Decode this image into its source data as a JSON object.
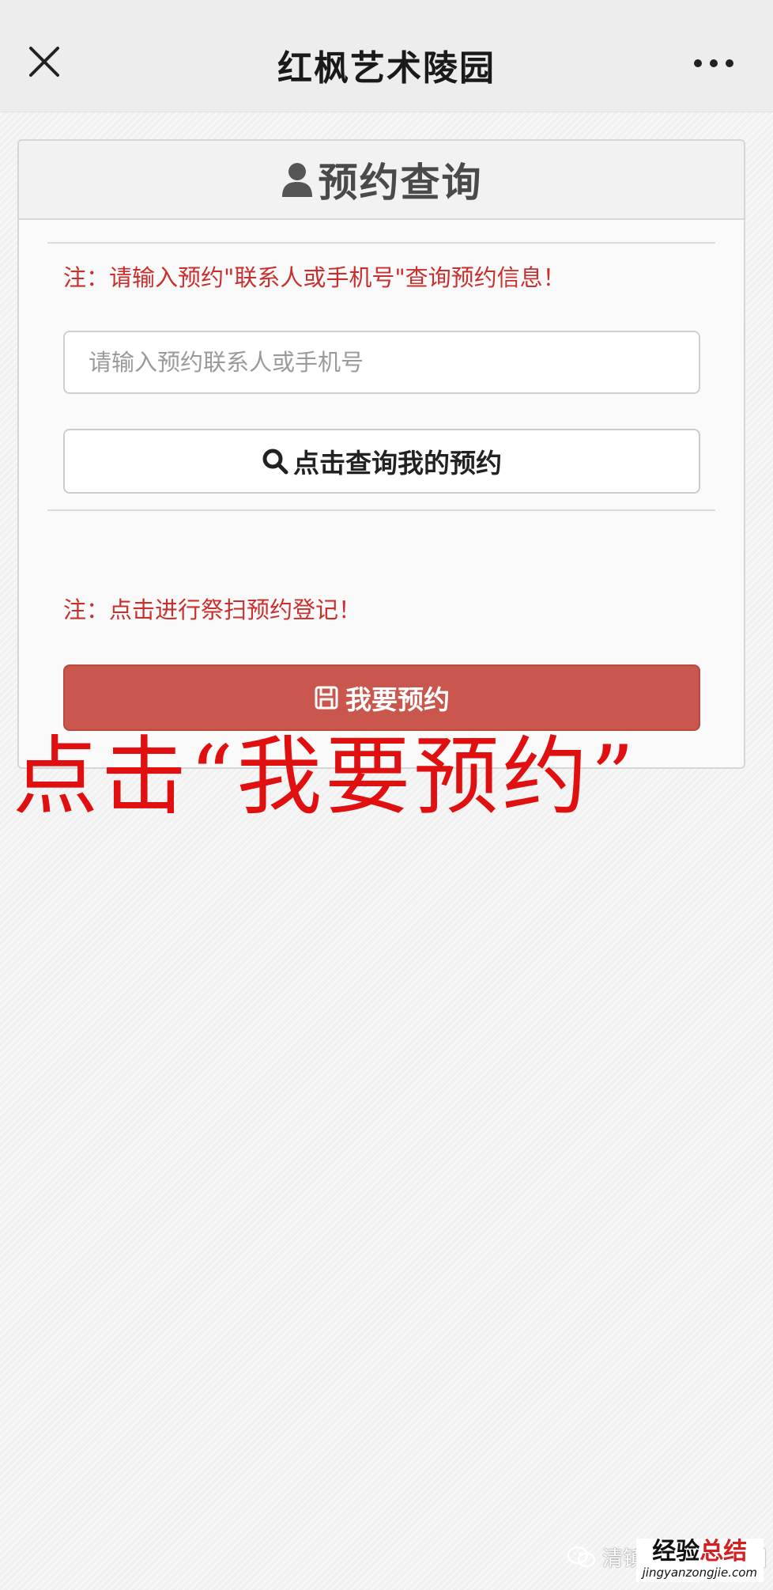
{
  "header": {
    "title": "红枫艺术陵园",
    "close_icon": "close-icon",
    "more_icon": "more-dots-icon"
  },
  "panel": {
    "title": "预约查询",
    "title_icon": "user-icon",
    "query_note": "注：请输入预约\"联系人或手机号\"查询预约信息！",
    "search_placeholder": "请输入预约联系人或手机号",
    "search_value": "",
    "query_button_label": "点击查询我的预约",
    "query_button_icon": "search-icon",
    "reserve_note": "注：点击进行祭扫预约登记！",
    "reserve_button_label": "我要预约",
    "reserve_button_icon": "save-icon"
  },
  "annotation": "点击“我要预约”",
  "watermark": {
    "text": "清镇红枫艺术陵园",
    "icon": "wechat-icon"
  },
  "site_badge": {
    "name_prefix": "经验",
    "name_suffix": "总结",
    "url": "jingyanzongjie.com"
  },
  "colors": {
    "note_red": "#c9302c",
    "reserve_button": "#c9574e",
    "annotation_red": "#e01010"
  }
}
